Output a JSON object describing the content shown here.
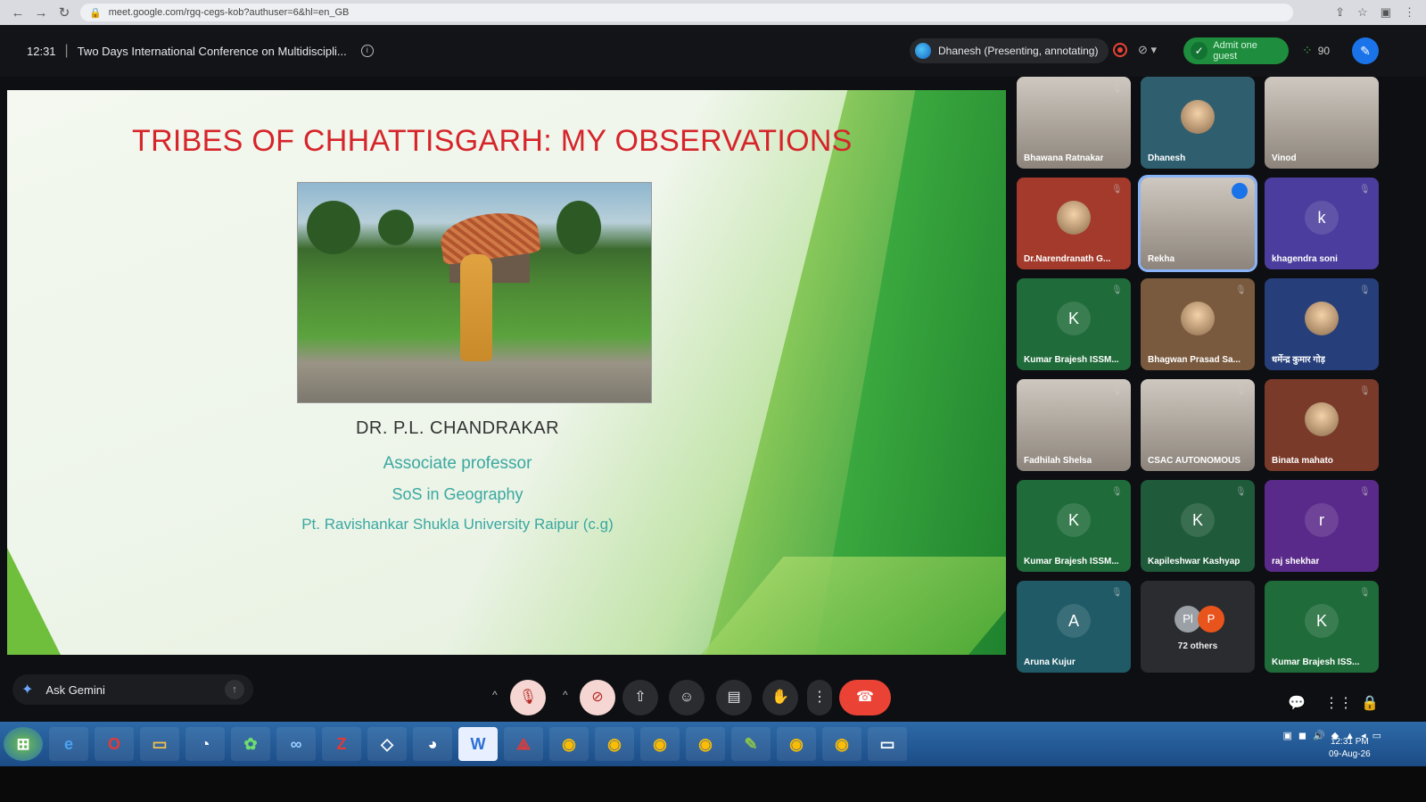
{
  "browser": {
    "url": "meet.google.com/rgq-cegs-kob?authuser=6&hl=en_GB"
  },
  "meeting": {
    "time": "12:31",
    "title": "Two Days International Conference on Multidiscipli...",
    "presenter_chip": "Dhanesh (Presenting, annotating)",
    "admit_label": "Admit one guest",
    "people_count": "90"
  },
  "slide": {
    "title": "TRIBES OF CHHATTISGARH: MY OBSERVATIONS",
    "name": "DR. P.L. CHANDRAKAR",
    "role": "Associate professor",
    "department": "SoS in Geography",
    "university": "Pt. Ravishankar Shukla University Raipur (c.g)"
  },
  "participants": [
    {
      "name": "Bhawana Ratnakar",
      "type": "camera",
      "muted": true
    },
    {
      "name": "Dhanesh",
      "type": "avatar",
      "initial": "",
      "color": "#2f5f6f",
      "muted": false
    },
    {
      "name": "Vinod",
      "type": "camera",
      "muted": false
    },
    {
      "name": "Dr.Narendranath G...",
      "type": "avatar",
      "initial": "",
      "color": "#a33a2c",
      "muted": true
    },
    {
      "name": "Rekha",
      "type": "camera",
      "muted": false,
      "speaking": true
    },
    {
      "name": "khagendra soni",
      "type": "avatar",
      "initial": "k",
      "color": "#4a3d9e",
      "muted": true
    },
    {
      "name": "Kumar Brajesh ISSM...",
      "type": "avatar",
      "initial": "K",
      "color": "#1f6b3a",
      "muted": true
    },
    {
      "name": "Bhagwan Prasad Sa...",
      "type": "avatar",
      "initial": "",
      "color": "#7a5a3e",
      "muted": true
    },
    {
      "name": "धर्मेन्द्र कुमार गोड़",
      "type": "avatar",
      "initial": "",
      "color": "#263f7a",
      "muted": true
    },
    {
      "name": "Fadhilah Shelsa",
      "type": "camera",
      "muted": true
    },
    {
      "name": "CSAC AUTONOMOUS",
      "type": "camera",
      "muted": true
    },
    {
      "name": "Binata mahato",
      "type": "avatar",
      "initial": "",
      "color": "#7a3a2a",
      "muted": true
    },
    {
      "name": "Kumar Brajesh ISSM...",
      "type": "avatar",
      "initial": "K",
      "color": "#1f6b3a",
      "muted": true
    },
    {
      "name": "Kapileshwar Kashyap",
      "type": "avatar",
      "initial": "K",
      "color": "#1f5a3a",
      "muted": true
    },
    {
      "name": "raj shekhar",
      "type": "avatar",
      "initial": "r",
      "color": "#5a2a8a",
      "muted": true
    },
    {
      "name": "Aruna Kujur",
      "type": "avatar",
      "initial": "A",
      "color": "#1f5a66",
      "muted": true
    },
    {
      "name": "72 others",
      "type": "others",
      "initial1": "Pl",
      "initial2": "P"
    },
    {
      "name": "Kumar Brajesh ISS...",
      "type": "avatar",
      "initial": "K",
      "color": "#1f6b3a",
      "muted": true
    }
  ],
  "bottom": {
    "gemini_label": "Ask Gemini"
  },
  "taskbar": {
    "clock_time": "12:31 PM",
    "clock_date": "09-Aug-26"
  },
  "colors": {
    "slide_title": "#d6252a",
    "slide_subtext": "#3aa8a0",
    "admit_bg": "#1e8e3e",
    "end_call": "#ea4335"
  }
}
